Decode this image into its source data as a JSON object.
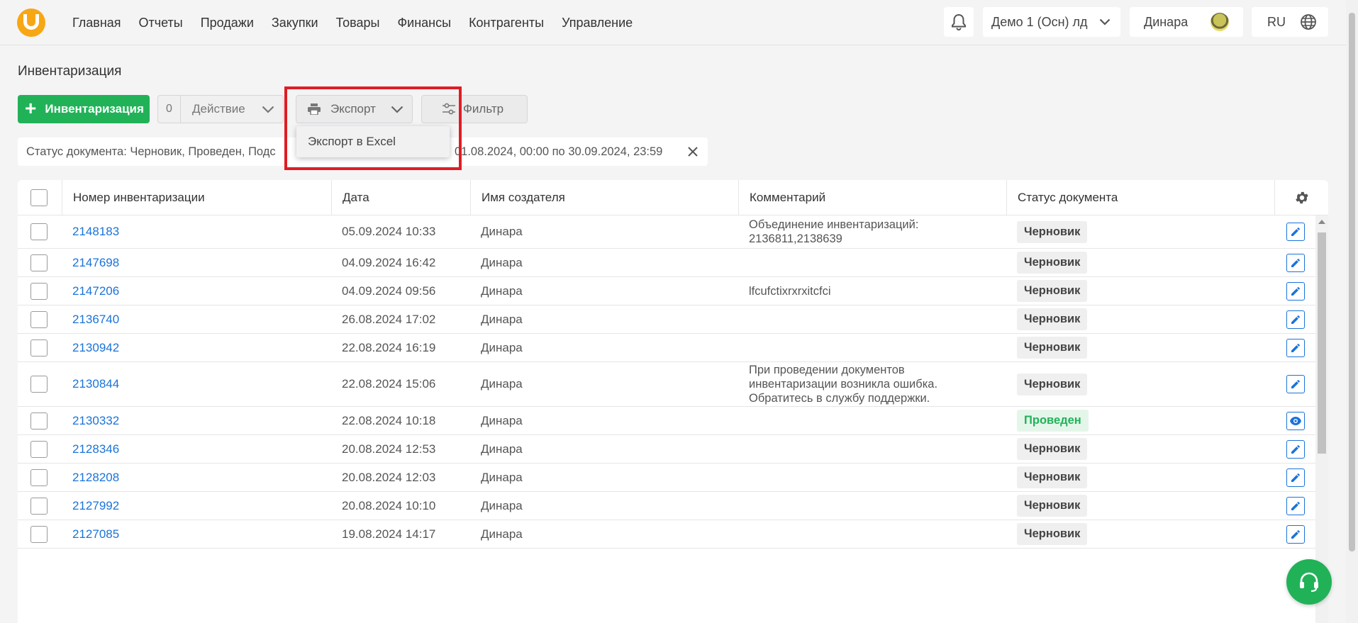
{
  "nav": {
    "logo": "U",
    "items": [
      "Главная",
      "Отчеты",
      "Продажи",
      "Закупки",
      "Товары",
      "Финансы",
      "Контрагенты",
      "Управление"
    ]
  },
  "header": {
    "company": "Демо 1 (Осн) лд",
    "user": "Динара",
    "lang": "RU"
  },
  "page": {
    "title": "Инвентаризация"
  },
  "toolbar": {
    "add_label": "Инвентаризация",
    "action_count": "0",
    "action_label": "Действие",
    "export_label": "Экспорт",
    "filter_label": "Фильтр"
  },
  "export_menu": {
    "items": [
      "Экспорт в Excel"
    ]
  },
  "filter_chip": {
    "status_text": "Статус документа: Черновик, Проведен, Подс",
    "date_text": "01.08.2024, 00:00 по 30.09.2024, 23:59"
  },
  "table": {
    "headers": [
      "Номер инвентаризации",
      "Дата",
      "Имя создателя",
      "Комментарий",
      "Статус документа"
    ],
    "rows": [
      {
        "number": "2148183",
        "date": "05.09.2024 10:33",
        "creator": "Динара",
        "comment": "Объединение инвентаризаций: 2136811,2138639",
        "status": "Черновик",
        "status_type": "draft",
        "action": "edit"
      },
      {
        "number": "2147698",
        "date": "04.09.2024 16:42",
        "creator": "Динара",
        "comment": "",
        "status": "Черновик",
        "status_type": "draft",
        "action": "edit"
      },
      {
        "number": "2147206",
        "date": "04.09.2024 09:56",
        "creator": "Динара",
        "comment": "lfcufctixrxrxitcfci",
        "status": "Черновик",
        "status_type": "draft",
        "action": "edit"
      },
      {
        "number": "2136740",
        "date": "26.08.2024 17:02",
        "creator": "Динара",
        "comment": "",
        "status": "Черновик",
        "status_type": "draft",
        "action": "edit"
      },
      {
        "number": "2130942",
        "date": "22.08.2024 16:19",
        "creator": "Динара",
        "comment": "",
        "status": "Черновик",
        "status_type": "draft",
        "action": "edit"
      },
      {
        "number": "2130844",
        "date": "22.08.2024 15:06",
        "creator": "Динара",
        "comment": "При проведении документов инвентаризации возникла ошибка. Обратитесь в службу поддержки.",
        "status": "Черновик",
        "status_type": "draft",
        "action": "edit"
      },
      {
        "number": "2130332",
        "date": "22.08.2024 10:18",
        "creator": "Динара",
        "comment": "",
        "status": "Проведен",
        "status_type": "done",
        "action": "view"
      },
      {
        "number": "2128346",
        "date": "20.08.2024 12:53",
        "creator": "Динара",
        "comment": "",
        "status": "Черновик",
        "status_type": "draft",
        "action": "edit"
      },
      {
        "number": "2128208",
        "date": "20.08.2024 12:03",
        "creator": "Динара",
        "comment": "",
        "status": "Черновик",
        "status_type": "draft",
        "action": "edit"
      },
      {
        "number": "2127992",
        "date": "20.08.2024 10:10",
        "creator": "Динара",
        "comment": "",
        "status": "Черновик",
        "status_type": "draft",
        "action": "edit"
      },
      {
        "number": "2127085",
        "date": "19.08.2024 14:17",
        "creator": "Динара",
        "comment": "",
        "status": "Черновик",
        "status_type": "draft",
        "action": "edit"
      }
    ]
  },
  "colors": {
    "accent_green": "#21b258",
    "link_blue": "#1a73d9",
    "highlight_red": "#e01c24",
    "logo_orange": "#f7a714"
  }
}
